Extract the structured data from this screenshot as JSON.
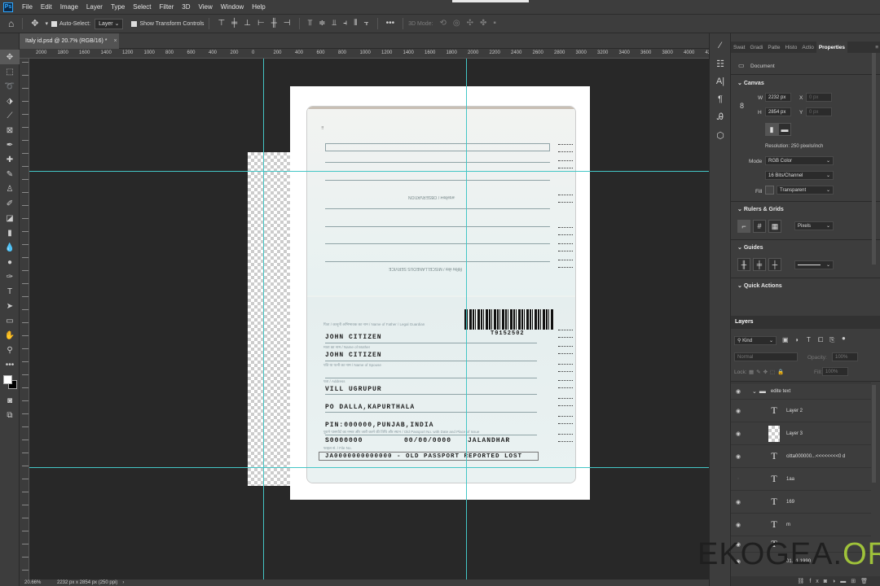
{
  "menubar": {
    "app_icon": "Ps",
    "items": [
      "File",
      "Edit",
      "Image",
      "Layer",
      "Type",
      "Select",
      "Filter",
      "3D",
      "View",
      "Window",
      "Help"
    ]
  },
  "options": {
    "auto_select_label": "Auto-Select:",
    "auto_select_value": "Layer",
    "transform_controls_label": "Show Transform Controls",
    "mode_3d_label": "3D Mode:"
  },
  "doc_tab": {
    "title": "Italy id.psd @ 20.7% (RGB/16) *",
    "close": "×"
  },
  "ruler_top_labels": [
    "2000",
    "1800",
    "1600",
    "1400",
    "1200",
    "1000",
    "800",
    "600",
    "400",
    "200",
    "0",
    "200",
    "400",
    "600",
    "800",
    "1000",
    "1200",
    "1400",
    "1600",
    "1800",
    "2000",
    "2200",
    "2400",
    "2600",
    "2800",
    "3000",
    "3200",
    "3400",
    "3600",
    "3800",
    "4000",
    "420"
  ],
  "passport": {
    "upper_caption_1": "अवलोकन / OBSERVATION",
    "upper_caption_2": "विविध सेवा / MISCELLANEOUS SERVICE",
    "label_father": "पिता / कानूनी अभिभावक का नाम / Name of Father / Legal Guardian",
    "label_mother": "माता का नाम / Name of Mother",
    "label_spouse": "पति या पत्नी का नाम / Name of Spouse",
    "label_address": "पता / Address",
    "label_old_passport": "पुराने पासपोर्ट का नम्बर और जारी करने की तिथि और स्थान / Old Passport No. with Date and Place of Issue",
    "label_file_no": "फाइल सं. / File No.",
    "barcode_number": "T9152502",
    "father": "JOHN CITIZEN",
    "mother": "JOHN CITIZEN",
    "address_1": "VILL UGRUPUR",
    "address_2": "PO DALLA,KAPURTHALA",
    "address_3": "PIN:000000,PUNJAB,INDIA",
    "old_passport_no": "S0000000",
    "old_passport_date": "00/00/0000",
    "old_passport_place": "JALANDHAR",
    "file_no": "JA0000000000000 - OLD PASSPORT REPORTED LOST"
  },
  "panel": {
    "tabs": [
      "Swat",
      "Gradi",
      "Patte",
      "Histo",
      "Actio",
      "Properties"
    ],
    "doc_label": "Document",
    "canvas_title": "Canvas",
    "w_label": "W",
    "w_value": "2232 px",
    "h_label": "H",
    "h_value": "2854 px",
    "x_label": "X",
    "x_value": "0 px",
    "y_label": "Y",
    "y_value": "0 px",
    "resolution": "Resolution: 250 pixels/inch",
    "mode_label": "Mode",
    "mode_value": "RGB Color",
    "bits_value": "16 Bits/Channel",
    "fill_label": "Fill",
    "fill_value": "Transparent",
    "rulers_title": "Rulers & Grids",
    "rulers_unit": "Pixels",
    "guides_title": "Guides",
    "quick_title": "Quick Actions"
  },
  "layers": {
    "title": "Layers",
    "kind": "Kind",
    "blend": "Normal",
    "opacity_label": "Opacity:",
    "opacity": "100%",
    "lock_label": "Lock:",
    "fill_label": "Fill:",
    "fill": "100%",
    "group": "edite text",
    "items": [
      "Layer 2",
      "Layer 3",
      "citta000000...<<<<<<<<0 d",
      "1aa",
      "169",
      "m",
      "",
      "01.01.1990"
    ]
  },
  "status": {
    "zoom": "20.66%",
    "size": "2232 px x 2854 px (250 ppi)"
  },
  "watermark": {
    "main": "EKOGEA",
    "dot": ".",
    "tld": "ORG"
  }
}
